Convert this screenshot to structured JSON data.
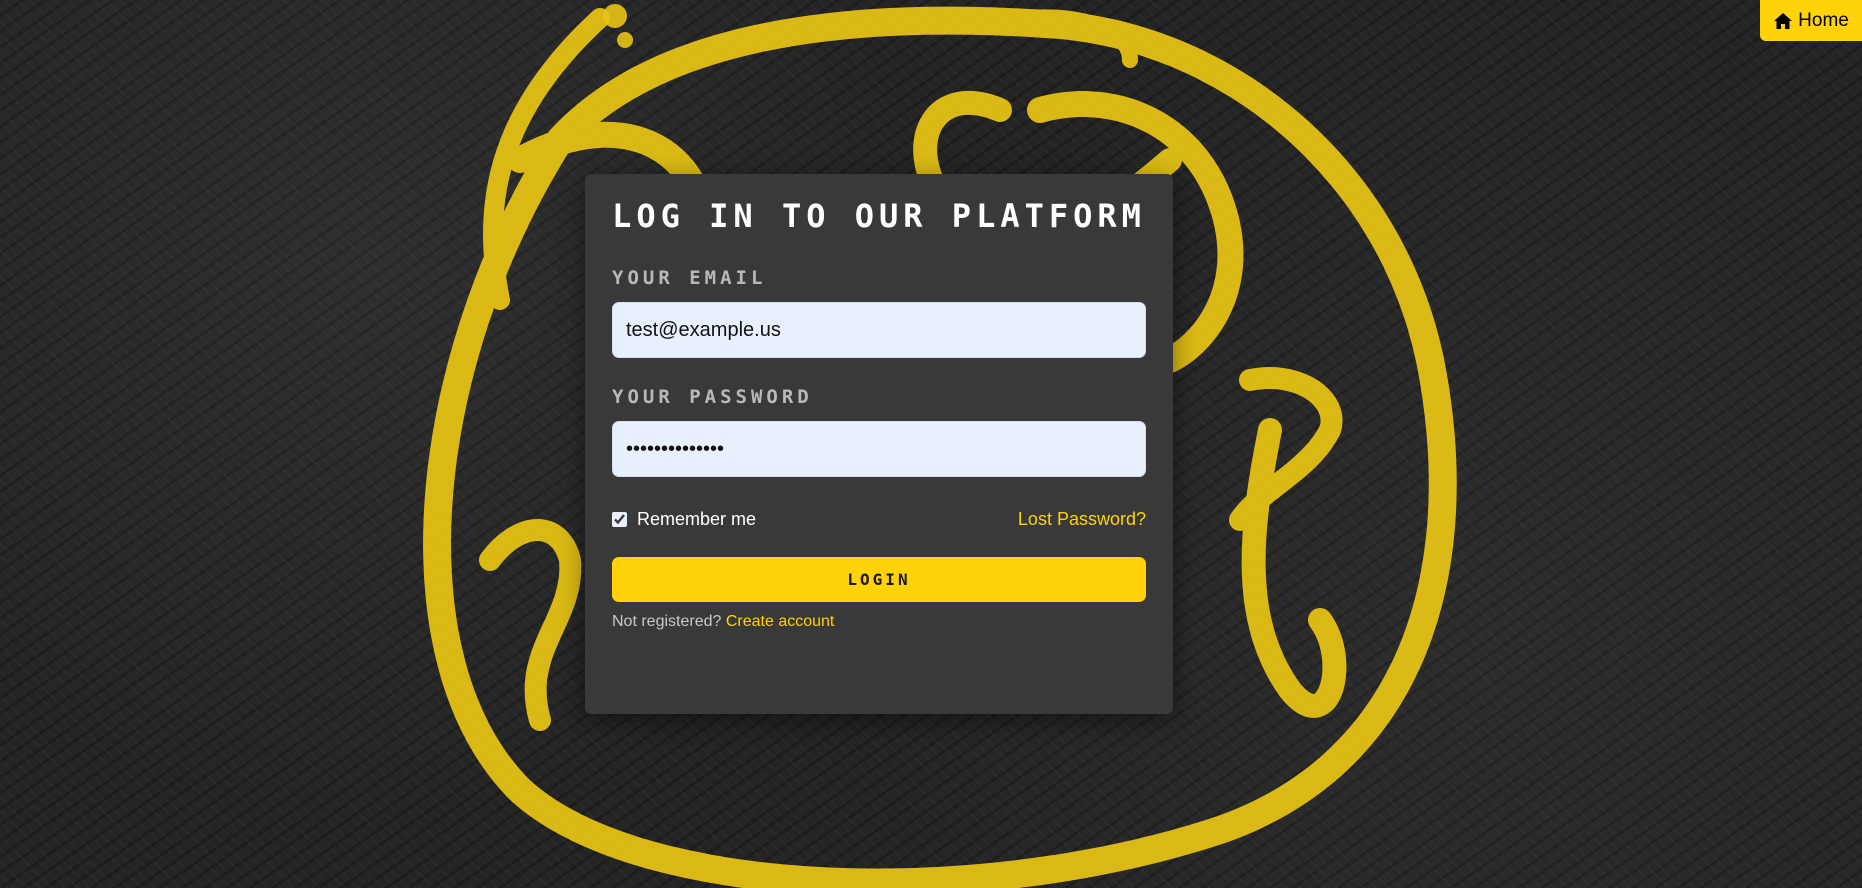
{
  "colors": {
    "accent": "#ffd20a",
    "card_background": "#393939",
    "page_background": "#242424",
    "input_background": "#e8f0fe"
  },
  "nav": {
    "home_label": "Home",
    "home_icon": "home-icon"
  },
  "login_form": {
    "title": "Log in to our platform",
    "email_label": "Your email",
    "email_value": "test@example.us",
    "password_label": "Your password",
    "password_value": "testpassword12",
    "remember_label": "Remember me",
    "remember_checked": true,
    "lost_password_label": "Lost Password?",
    "login_button_label": "Login",
    "not_registered_text": "Not registered?",
    "create_account_label": "Create account"
  }
}
